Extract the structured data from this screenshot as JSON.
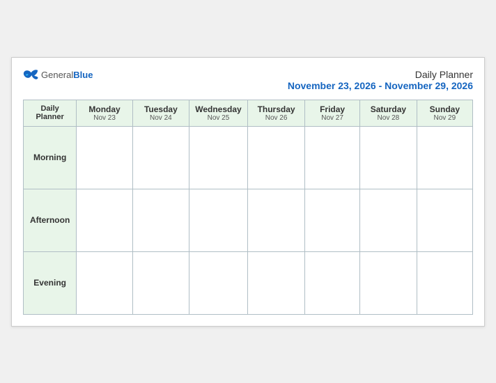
{
  "header": {
    "logo_general": "General",
    "logo_blue": "Blue",
    "title": "Daily Planner",
    "date_range": "November 23, 2026 - November 29, 2026"
  },
  "table": {
    "col_header_label": "Daily\nPlanner",
    "col_header_label_line1": "Daily",
    "col_header_label_line2": "Planner",
    "days": [
      {
        "name": "Monday",
        "date": "Nov 23"
      },
      {
        "name": "Tuesday",
        "date": "Nov 24"
      },
      {
        "name": "Wednesday",
        "date": "Nov 25"
      },
      {
        "name": "Thursday",
        "date": "Nov 26"
      },
      {
        "name": "Friday",
        "date": "Nov 27"
      },
      {
        "name": "Saturday",
        "date": "Nov 28"
      },
      {
        "name": "Sunday",
        "date": "Nov 29"
      }
    ],
    "rows": [
      {
        "label": "Morning"
      },
      {
        "label": "Afternoon"
      },
      {
        "label": "Evening"
      }
    ]
  }
}
